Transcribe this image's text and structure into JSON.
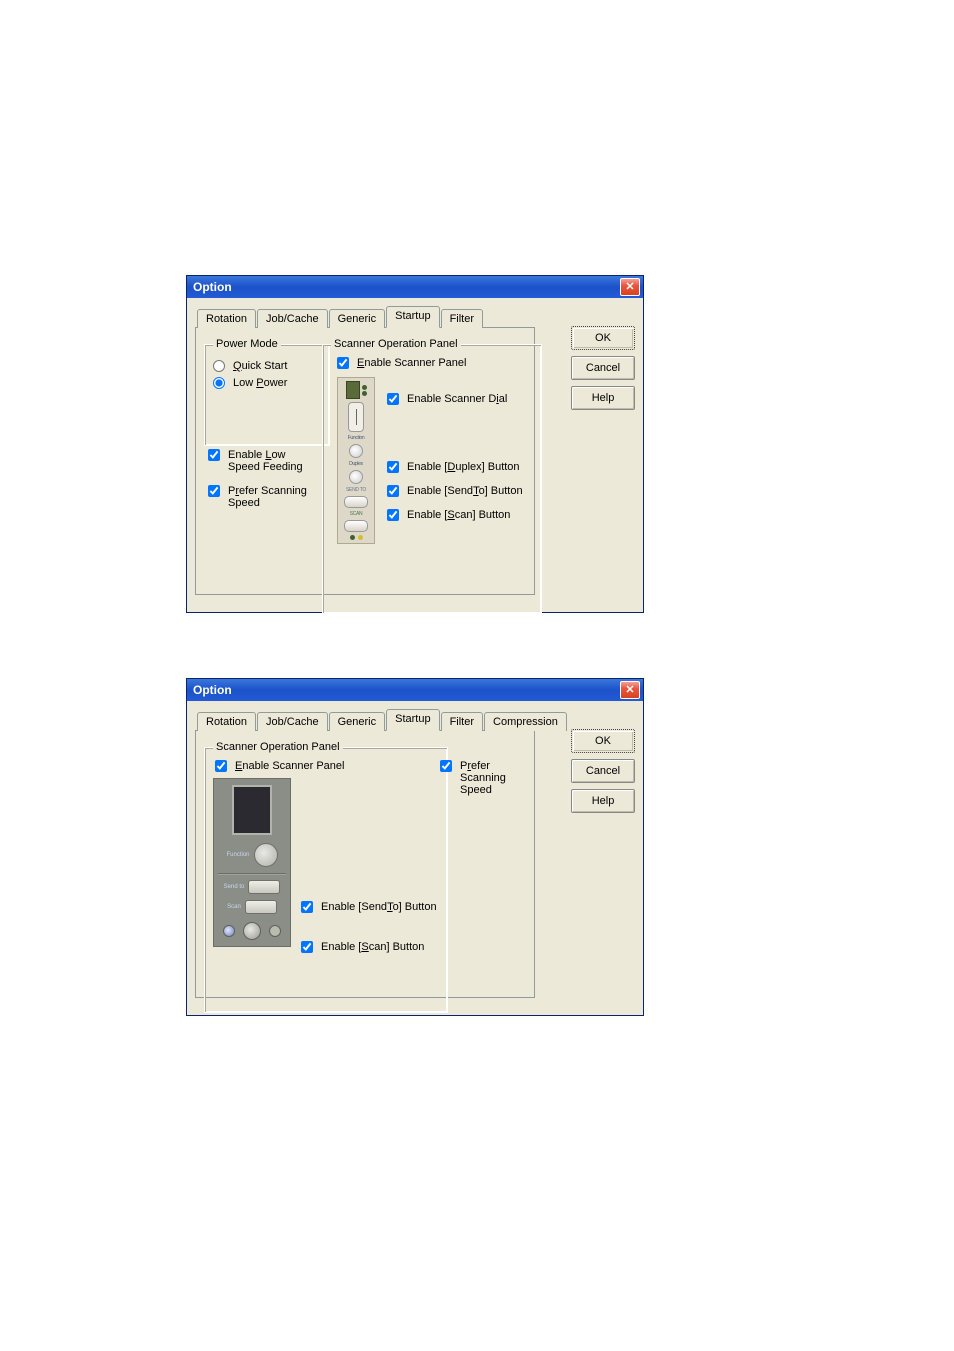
{
  "dialog1": {
    "title": "Option",
    "tabs": [
      "Rotation",
      "Job/Cache",
      "Generic",
      "Startup",
      "Filter"
    ],
    "active_tab": 3,
    "powerMode": {
      "legend": "Power Mode",
      "quickStart": "Quick Start",
      "lowPower": "Low Power",
      "enableLowSpeed": "Enable Low Speed Feeding",
      "preferScanning": "Prefer Scanning Speed"
    },
    "sop": {
      "legend": "Scanner Operation Panel",
      "enablePanel": "Enable Scanner Panel",
      "enableDial": "Enable Scanner Dial",
      "enableDuplex": "Enable [Duplex] Button",
      "enableSendTo": "Enable [SendTo] Button",
      "enableScan": "Enable [Scan] Button",
      "hw": {
        "function": "Function",
        "duplex": "Duplex",
        "sendto": "SEND TO",
        "scan": "SCAN"
      }
    },
    "buttons": {
      "ok": "OK",
      "cancel": "Cancel",
      "help": "Help"
    }
  },
  "dialog2": {
    "title": "Option",
    "tabs": [
      "Rotation",
      "Job/Cache",
      "Generic",
      "Startup",
      "Filter",
      "Compression"
    ],
    "active_tab": 3,
    "sop": {
      "legend": "Scanner Operation Panel",
      "enablePanel": "Enable Scanner Panel",
      "enableSendTo": "Enable [SendTo] Button",
      "enableScan": "Enable [Scan] Button",
      "hw": {
        "function": "Function",
        "sendto": "Send to",
        "scan": "Scan"
      }
    },
    "preferScanning": "Prefer Scanning Speed",
    "buttons": {
      "ok": "OK",
      "cancel": "Cancel",
      "help": "Help"
    }
  }
}
